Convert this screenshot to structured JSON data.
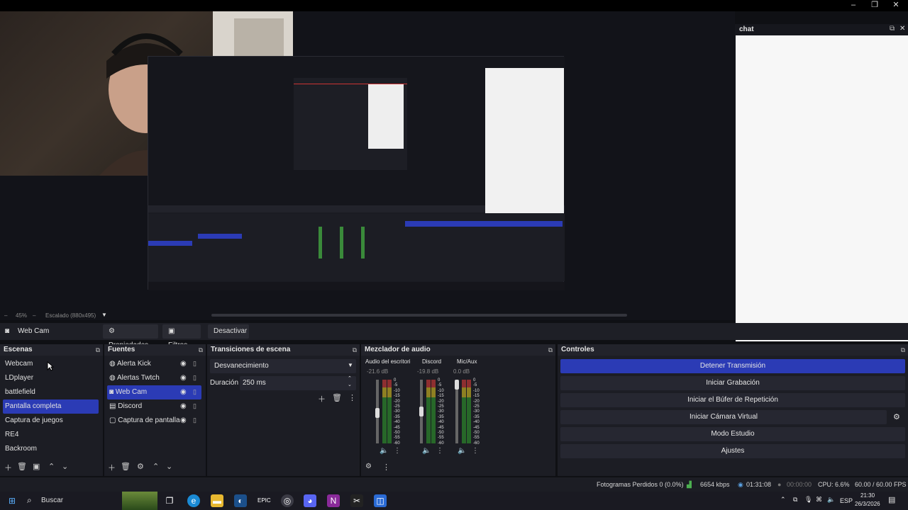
{
  "window": {
    "minimize": "–",
    "restore": "❐",
    "close": "✕"
  },
  "chat_dock": {
    "title": "chat",
    "float": "⧉",
    "close": "✕"
  },
  "zoom": {
    "level": "45%",
    "scaling": "Escalado (880x495)"
  },
  "source_toolbar": {
    "current_source": "Web Cam",
    "properties": "Propiedades",
    "filters": "Filtros",
    "deactivate": "Desactivar"
  },
  "scenes": {
    "title": "Escenas",
    "items": [
      {
        "label": "Webcam",
        "selected": false
      },
      {
        "label": "LDplayer",
        "selected": false
      },
      {
        "label": "battlefield",
        "selected": false
      },
      {
        "label": "Pantalla completa",
        "selected": true
      },
      {
        "label": "Captura de juegos",
        "selected": false
      },
      {
        "label": "RE4",
        "selected": false
      },
      {
        "label": "Backroom",
        "selected": false
      }
    ]
  },
  "sources": {
    "title": "Fuentes",
    "items": [
      {
        "label": "Alerta Kick",
        "icon": "browser-icon",
        "selected": false
      },
      {
        "label": "Alertas Twtch",
        "icon": "browser-icon",
        "selected": false
      },
      {
        "label": "Web Cam",
        "icon": "camera-icon",
        "selected": true
      },
      {
        "label": "Discord",
        "icon": "window-icon",
        "selected": false
      },
      {
        "label": "Captura de pantalla",
        "icon": "monitor-icon",
        "selected": false
      }
    ]
  },
  "transitions": {
    "title": "Transiciones de escena",
    "selected": "Desvanecimiento",
    "duration_label": "Duración",
    "duration_value": "250 ms"
  },
  "mixer": {
    "title": "Mezclador de audio",
    "channels": [
      {
        "name": "Audio del escritorio",
        "db": "-21.6 dB",
        "fader": 0.7
      },
      {
        "name": "Discord",
        "db": "-19.8 dB",
        "fader": 0.72
      },
      {
        "name": "Mic/Aux",
        "db": "0.0 dB",
        "fader": 1.0
      }
    ],
    "scale": [
      "0",
      "-5",
      "-10",
      "-15",
      "-20",
      "-25",
      "-30",
      "-35",
      "-40",
      "-45",
      "-50",
      "-55",
      "-60"
    ]
  },
  "controls": {
    "title": "Controles",
    "stop_stream": "Detener Transmisión",
    "start_recording": "Iniciar Grabación",
    "start_replay": "Iniciar el Búfer de Repetición",
    "virtual_cam": "Iniciar Cámara Virtual",
    "studio_mode": "Modo Estudio",
    "settings": "Ajustes"
  },
  "status": {
    "dropped": "Fotogramas Perdidos 0 (0.0%)",
    "bitrate": "6654 kbps",
    "stream_time": "01:31:08",
    "rec_time": "00:00:00",
    "cpu": "CPU: 6.6%",
    "fps": "60.00 / 60.00 FPS"
  },
  "taskbar": {
    "search": "Buscar",
    "lang": "ESP",
    "time": "21:30",
    "date": "26/3/2026"
  },
  "colors": {
    "accent": "#2b3bb5",
    "panel": "#1c1d24",
    "header": "#22232b"
  }
}
